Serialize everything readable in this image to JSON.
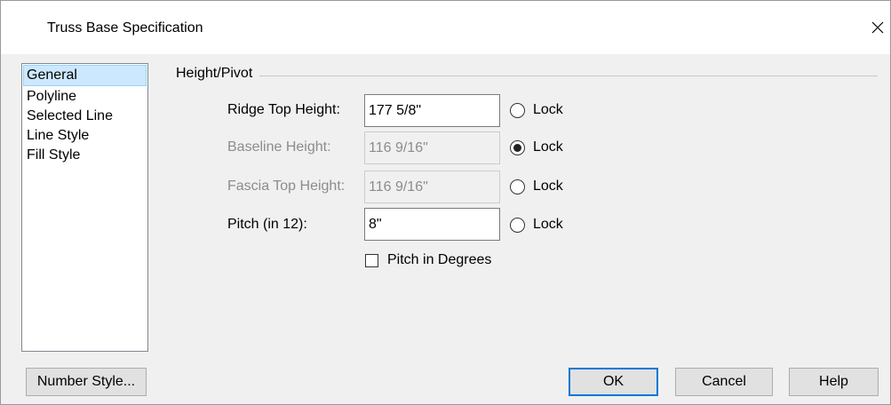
{
  "window": {
    "title": "Truss Base Specification",
    "close_icon": "close-icon"
  },
  "sidebar": {
    "items": [
      {
        "label": "General",
        "selected": true
      },
      {
        "label": "Polyline",
        "selected": false
      },
      {
        "label": "Selected Line",
        "selected": false
      },
      {
        "label": "Line Style",
        "selected": false
      },
      {
        "label": "Fill Style",
        "selected": false
      }
    ]
  },
  "group": {
    "label": "Height/Pivot"
  },
  "fields": {
    "ridge_top_height": {
      "label": "Ridge Top Height:",
      "value": "177 5/8\"",
      "enabled": true,
      "lock_label": "Lock",
      "locked": false
    },
    "baseline_height": {
      "label": "Baseline Height:",
      "value": "116 9/16\"",
      "enabled": false,
      "lock_label": "Lock",
      "locked": true
    },
    "fascia_top_height": {
      "label": "Fascia Top Height:",
      "value": "116 9/16\"",
      "enabled": false,
      "lock_label": "Lock",
      "locked": false
    },
    "pitch": {
      "label": "Pitch (in 12):",
      "value": "8\"",
      "enabled": true,
      "lock_label": "Lock",
      "locked": false
    }
  },
  "pitch_in_degrees": {
    "label": "Pitch in Degrees",
    "checked": false
  },
  "buttons": {
    "number_style": "Number Style...",
    "ok": "OK",
    "cancel": "Cancel",
    "help": "Help"
  }
}
